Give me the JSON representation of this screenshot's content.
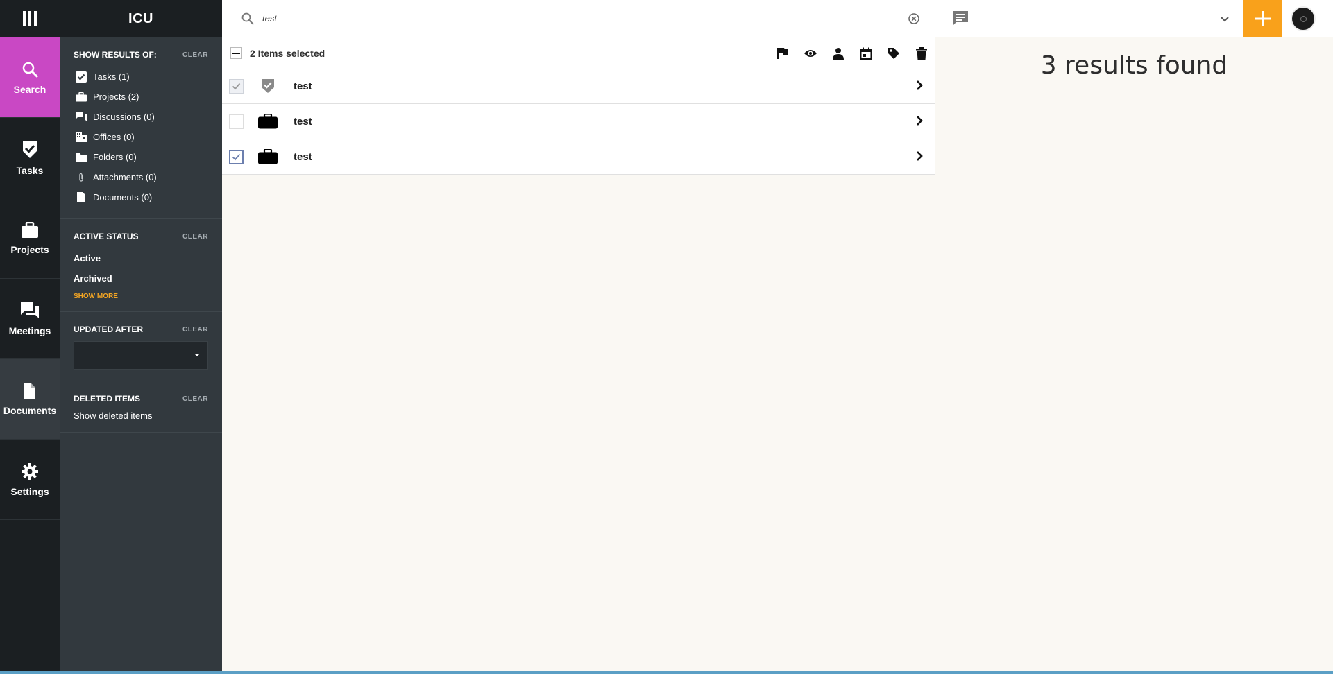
{
  "nav": {
    "items": [
      {
        "key": "search",
        "label": "Search"
      },
      {
        "key": "tasks",
        "label": "Tasks"
      },
      {
        "key": "projects",
        "label": "Projects"
      },
      {
        "key": "meetings",
        "label": "Meetings"
      },
      {
        "key": "documents",
        "label": "Documents"
      },
      {
        "key": "settings",
        "label": "Settings"
      }
    ]
  },
  "app": {
    "title": "ICU"
  },
  "filters": {
    "show_results_of": {
      "heading": "SHOW RESULTS OF:",
      "clear": "CLEAR",
      "items": [
        {
          "label": "Tasks (1)",
          "icon": "checkbox-checked-icon"
        },
        {
          "label": "Projects (2)",
          "icon": "briefcase-icon"
        },
        {
          "label": "Discussions (0)",
          "icon": "forum-icon"
        },
        {
          "label": "Offices (0)",
          "icon": "building-icon"
        },
        {
          "label": "Folders (0)",
          "icon": "folder-icon"
        },
        {
          "label": "Attachments (0)",
          "icon": "paperclip-icon"
        },
        {
          "label": "Documents (0)",
          "icon": "document-icon"
        }
      ]
    },
    "active_status": {
      "heading": "ACTIVE STATUS",
      "clear": "CLEAR",
      "items": [
        "Active",
        "Archived"
      ],
      "show_more": "SHOW MORE"
    },
    "updated_after": {
      "heading": "UPDATED AFTER",
      "clear": "CLEAR"
    },
    "deleted_items": {
      "heading": "DELETED ITEMS",
      "clear": "CLEAR",
      "link": "Show deleted items"
    }
  },
  "search": {
    "value": "test"
  },
  "selection": {
    "label": "2 Items selected"
  },
  "results_list": [
    {
      "title": "test",
      "type_icon": "task-shield-icon",
      "selected": true
    },
    {
      "title": "test",
      "type_icon": "briefcase-icon",
      "selected": false
    },
    {
      "title": "test",
      "type_icon": "briefcase-icon",
      "selected": true
    }
  ],
  "results_summary": "3 results found",
  "colors": {
    "accent_search": "#c948c4",
    "add_button": "#f9a11b",
    "show_more": "#f5a623"
  }
}
